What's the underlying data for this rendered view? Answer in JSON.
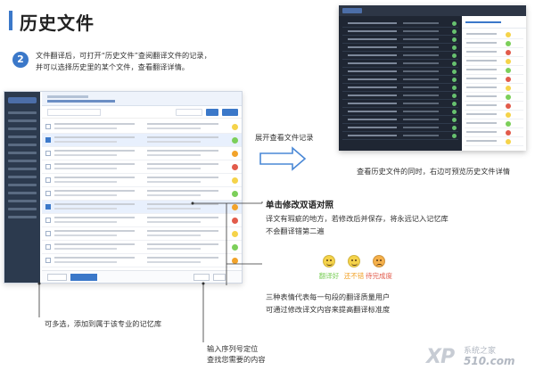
{
  "header": {
    "title": "历史文件"
  },
  "step": {
    "number": "2",
    "lines": [
      "文件翻译后，可打开“历史文件”查阅翻译文件的记录，",
      "并可以选择历史里的某个文件，查看翻译详情。"
    ]
  },
  "callouts": {
    "expand": "展开查看文件记录",
    "preview": "查看历史文件的同时，右边可预览历史文件详情",
    "click_title": "单击修改双语对照",
    "edit_lines": [
      "译文有瑕疵的地方，若修改后并保存，将永远记入记忆库",
      "不会翻译错第二遍"
    ],
    "rating_lines": [
      "三种表情代表每一句段的翻译质量用户",
      "可通过修改译文内容来提高翻译标准度"
    ],
    "multi_select": "可多选，添加到属于该专业的记忆库",
    "locate_lines": [
      "输入序列号定位",
      "查找您需要的内容"
    ]
  },
  "ratings": [
    {
      "label": "翻译好",
      "color": "#7ccf5a",
      "face_color": "#f5d34a",
      "mood": "happy"
    },
    {
      "label": "还不错",
      "color": "#f2a32a",
      "face_color": "#f5d34a",
      "mood": "happy"
    },
    {
      "label": "待完成度",
      "color": "#e25b4b",
      "face_color": "#f5b04a",
      "mood": "sad"
    }
  ],
  "watermark": {
    "logo": "XP",
    "site": "系统之家",
    "domain": "510.com"
  },
  "colors": {
    "accent": "#3b78c9",
    "arrow": "#4a88d6"
  }
}
